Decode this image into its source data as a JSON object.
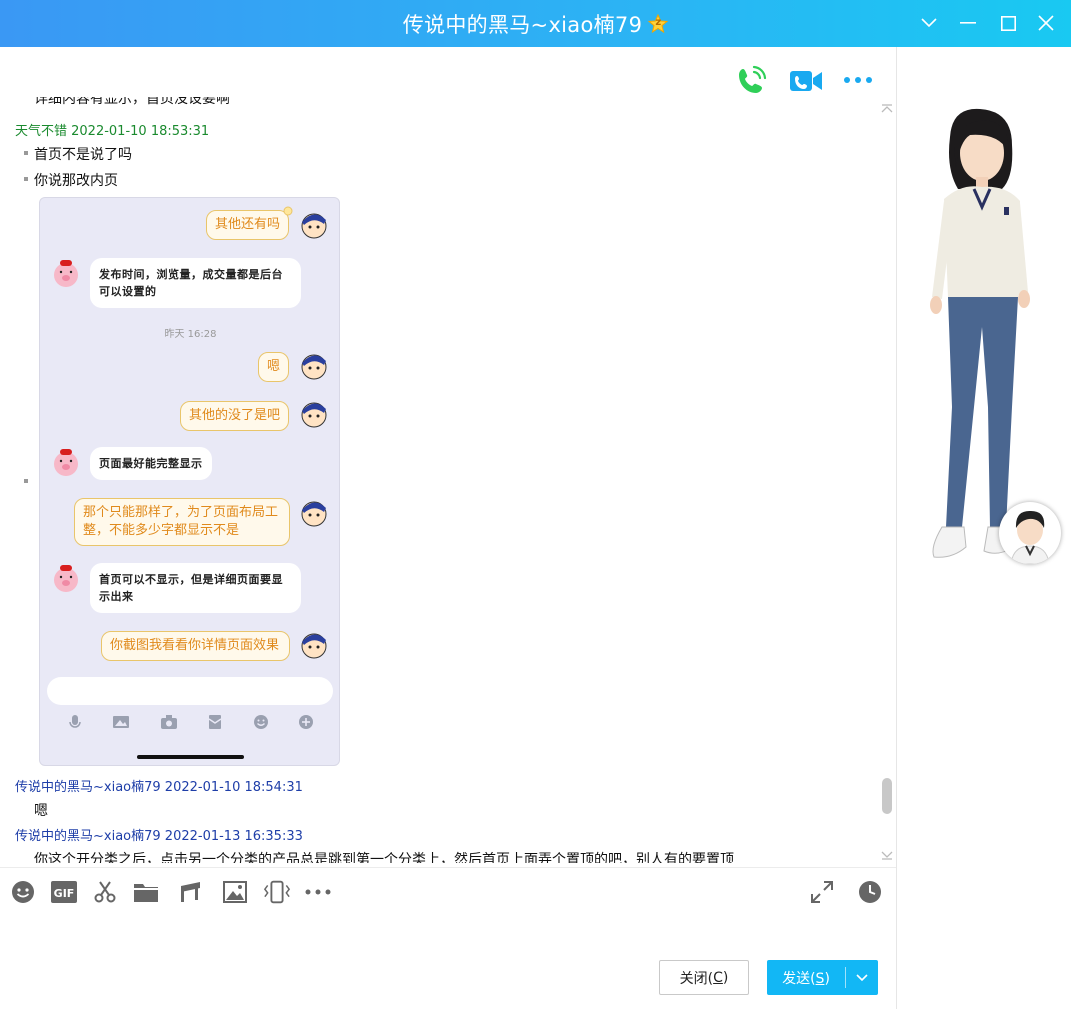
{
  "window": {
    "title": "传说中的黑马~xiao楠79",
    "badge": "z"
  },
  "messages": {
    "cut_top": "详细内容有显示，首页没设要啊",
    "m1_head": "天气不错 2022-01-10 18:53:31",
    "m1_line1": "首页不是说了吗",
    "m1_line2": "你说那改内页",
    "m2_head": "传说中的黑马~xiao楠79 2022-01-10 18:54:31",
    "m2_line1": "嗯",
    "m3_head": "传说中的黑马~xiao楠79 2022-01-13 16:35:33",
    "m3_line1": "你这个开分类之后，点击另一个分类的产品总是跳到第一个分类上，然后首页上面弄个置顶的吧，别人有的要置顶"
  },
  "phone": {
    "b1": "其他还有吗",
    "b2": "发布时间，浏览量，成交量都是后台可以设置的",
    "time": "昨天 16:28",
    "b3": "嗯",
    "b4": "其他的没了是吧",
    "b5": "页面最好能完整显示",
    "b6": "那个只能那样了，为了页面布局工整，不能多少字都显示不是",
    "b7": "首页可以不显示，但是详细页面要显示出来",
    "b8": "你截图我看看你详情页面效果"
  },
  "buttons": {
    "close": "关闭(",
    "close_key": "C",
    "close_end": ")",
    "send": "发送(",
    "send_key": "S",
    "send_end": ")"
  },
  "colors": {
    "accent": "#12b7f5",
    "sender_other": "#1a8a2e",
    "sender_self": "#1e3ea8"
  }
}
